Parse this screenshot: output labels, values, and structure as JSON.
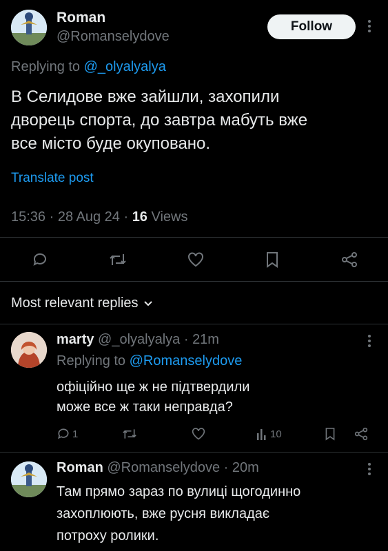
{
  "main_post": {
    "author_name": "Roman",
    "author_handle": "@Romanselydove",
    "follow_label": "Follow",
    "replying_prefix": "Replying to ",
    "replying_handle": "@_olyalyalya",
    "text_lines": [
      "В Селидове вже зайшли, захопили",
      "дворець спорта, до завтра мабуть вже",
      "все місто буде окуповано."
    ],
    "translate_label": "Translate post",
    "time": "15:36 · 28 Aug 24 · ",
    "views_count": "16",
    "views_label": " Views"
  },
  "actions": [
    "reply-icon",
    "repost-icon",
    "like-icon",
    "bookmark-icon",
    "share-icon"
  ],
  "replies_filter": "Most relevant replies",
  "reply1": {
    "name": "marty",
    "handle_time": " @_olyalyalya · 21m",
    "replying_prefix": "Replying to ",
    "replying_handle": "@Romanselydove",
    "text_lines": [
      "офіційно ще ж не підтвердили",
      "може все ж таки неправда?"
    ],
    "reply_count": "1",
    "views_count": "10"
  },
  "reply2": {
    "name": "Roman",
    "handle_time": " @Romanselydove · 20m",
    "text_lines": [
      "Там прямо зараз по вулиці щогодинно",
      "захоплюють, вже русня викладає",
      "потроху ролики."
    ]
  },
  "colors": {
    "accent": "#1d9bf0",
    "muted": "#71767b",
    "text": "#e7e9ea",
    "divider": "#2f3336"
  }
}
